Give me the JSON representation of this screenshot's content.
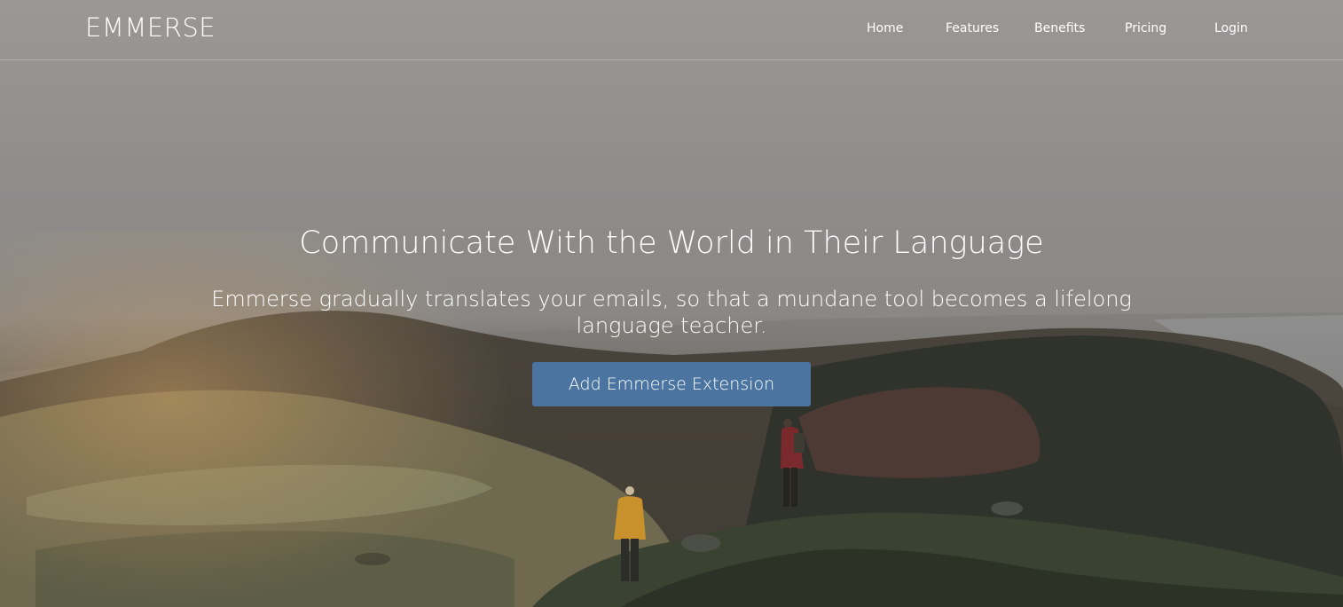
{
  "brand": {
    "name": "EMMERSE"
  },
  "nav": {
    "home": "Home",
    "features": "Features",
    "benefits": "Benefits",
    "pricing": "Pricing",
    "login": "Login"
  },
  "hero": {
    "headline": "Communicate With the World in Their Language",
    "subtext": "Emmerse gradually translates your emails, so that a mundane tool becomes a lifelong language teacher.",
    "cta_label": "Add Emmerse Extension"
  },
  "colors": {
    "cta": "#4b75a0",
    "text": "#ffffff"
  }
}
